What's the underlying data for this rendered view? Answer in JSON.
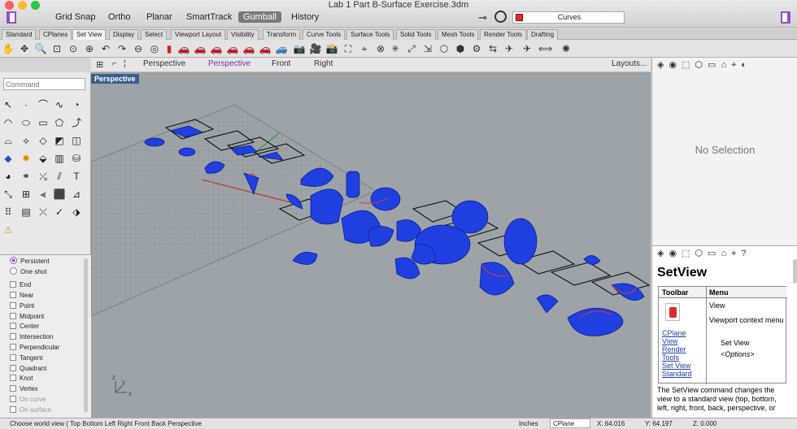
{
  "window": {
    "title": "Lab 1 Part B-Surface Exercise.3dm",
    "modes": [
      "Grid Snap",
      "Ortho",
      "Planar",
      "SmartTrack",
      "Gumball",
      "History"
    ],
    "active_mode": "Gumball",
    "layer": "Curves",
    "layer_color": "#e03030"
  },
  "tabs": [
    "Standard",
    "CPlanes",
    "Set View",
    "Display",
    "Select",
    "Viewport Layout",
    "Visibility",
    "Transform",
    "Curve Tools",
    "Surface Tools",
    "Solid Tools",
    "Mesh Tools",
    "Render Tools",
    "Drafting"
  ],
  "active_tab": "Set View",
  "viewport_tabs": [
    "Perspective",
    "Perspective",
    "Front",
    "Right"
  ],
  "viewport_tab_active_index": 1,
  "layouts_label": "Layouts...",
  "viewport": {
    "label": "Perspective"
  },
  "command": {
    "placeholder": "Command"
  },
  "osnap": {
    "modes": [
      {
        "label": "Persistent",
        "type": "radio",
        "checked": true
      },
      {
        "label": "One shot",
        "type": "radio",
        "checked": false
      }
    ],
    "items": [
      {
        "label": "End",
        "dim": false
      },
      {
        "label": "Near",
        "dim": false
      },
      {
        "label": "Point",
        "dim": false
      },
      {
        "label": "Midpoint",
        "dim": false
      },
      {
        "label": "Center",
        "dim": false
      },
      {
        "label": "Intersection",
        "dim": false
      },
      {
        "label": "Perpendicular",
        "dim": false
      },
      {
        "label": "Tangent",
        "dim": false
      },
      {
        "label": "Quadrant",
        "dim": false
      },
      {
        "label": "Knot",
        "dim": false
      },
      {
        "label": "Vertex",
        "dim": false
      },
      {
        "label": "On curve",
        "dim": true
      },
      {
        "label": "On surface",
        "dim": true
      }
    ]
  },
  "properties": {
    "empty_text": "No Selection"
  },
  "help": {
    "title": "SetView",
    "col_toolbar": "Toolbar",
    "col_menu": "Menu",
    "toolbar_links": [
      "CPlane",
      "View",
      "Render",
      "Tools",
      "Set View",
      "Standard"
    ],
    "menu_view": "View",
    "menu_context": "Viewport context menu",
    "menu_setview": "Set View",
    "menu_options": "<Options>",
    "description": "The SetView command changes the view to a standard view (top, bottom, left, right, front, back, perspective, or"
  },
  "status": {
    "prompt": "Choose world view ( Top Bottom Left Right Front Back Perspective",
    "units": "Inches",
    "cplane": "CPlane",
    "x": "X: 64.016",
    "y": "Y: 64.197",
    "z": "Z: 0.000"
  },
  "colors": {
    "accent": "#9b4bd0",
    "object_blue": "#1f3fe0",
    "viewport_bg": "#9ea3a8"
  }
}
